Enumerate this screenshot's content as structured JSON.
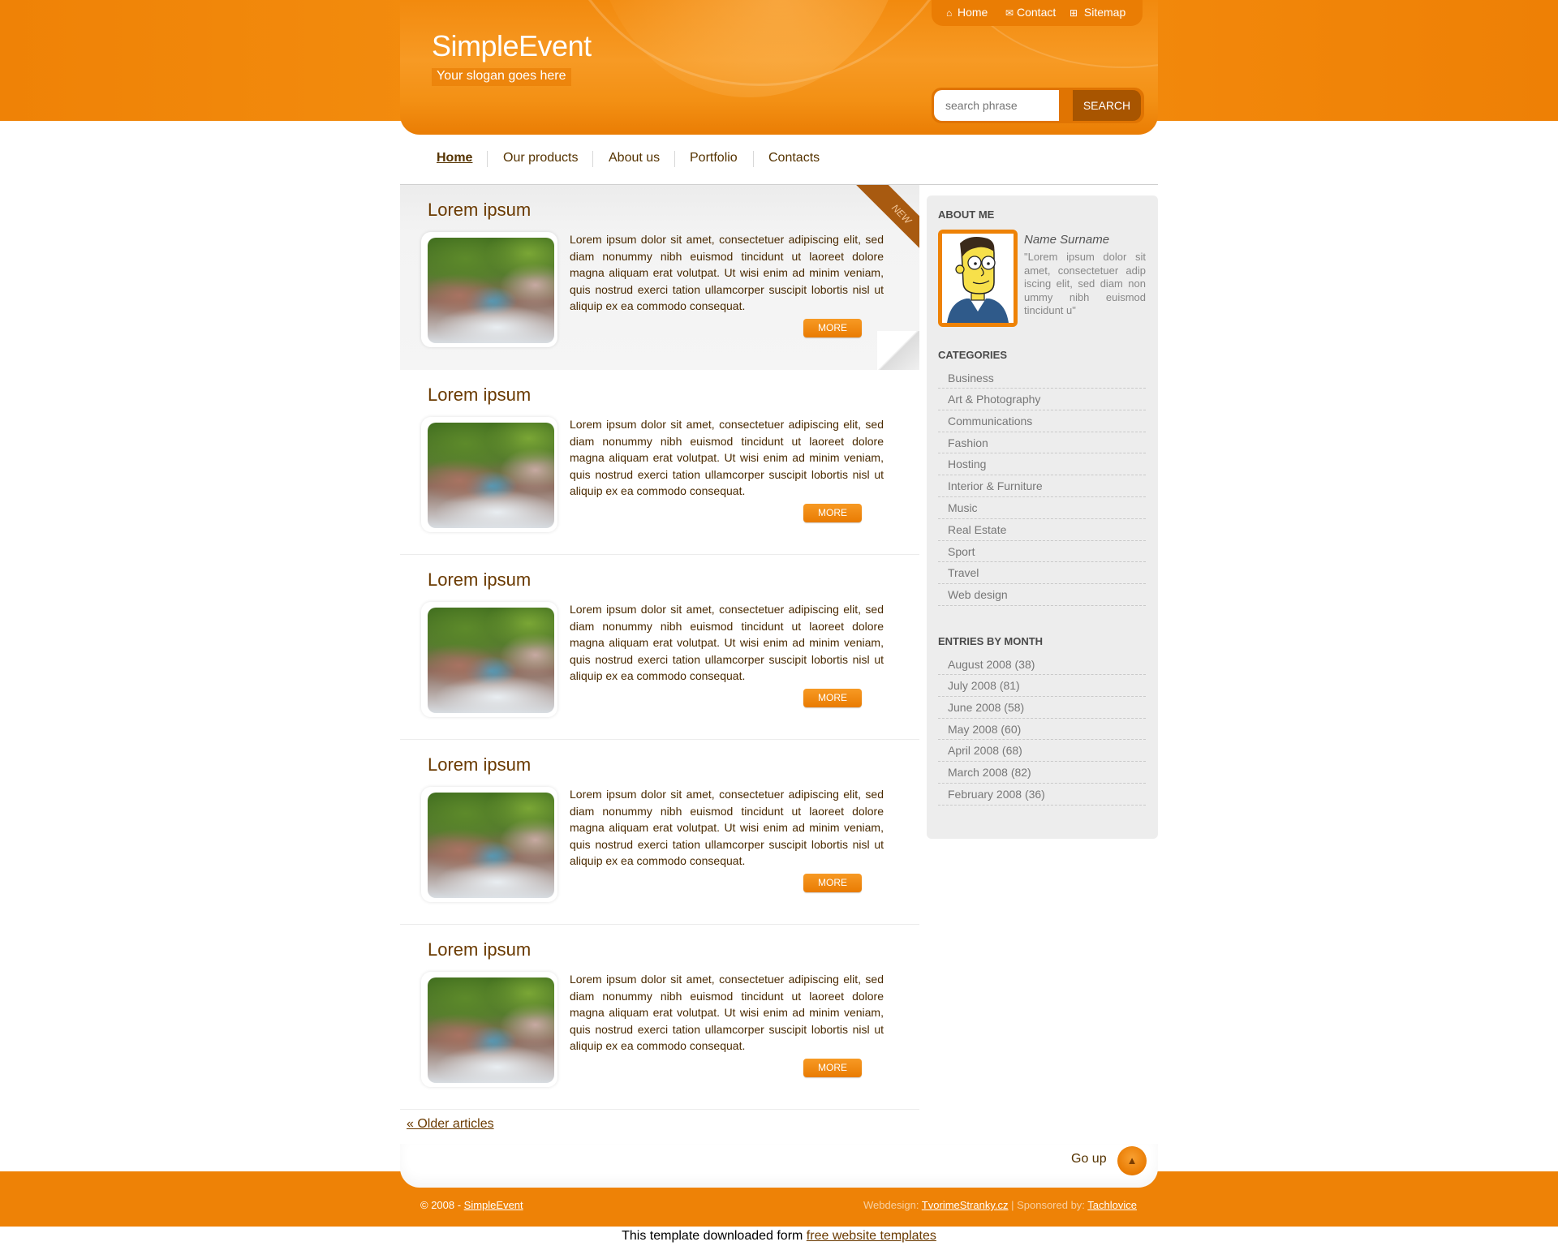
{
  "header": {
    "title": "SimpleEvent",
    "slogan": "Your slogan goes here",
    "top_links": [
      {
        "label": "Home",
        "icon": "home-icon"
      },
      {
        "label": "Contact",
        "icon": "mail-icon"
      },
      {
        "label": "Sitemap",
        "icon": "sitemap-icon"
      }
    ],
    "search": {
      "placeholder": "search phrase",
      "button_label": "SEARCH"
    }
  },
  "nav": {
    "items": [
      "Home",
      "Our products",
      "About us",
      "Portfolio",
      "Contacts"
    ],
    "active": "Home"
  },
  "articles": [
    {
      "title": "Lorem ipsum",
      "badge": "NEW",
      "body": "Lorem ipsum dolor sit amet, consectetuer adipiscing elit, sed diam nonummy nibh euismod tincidunt ut laoreet dolore magna aliquam erat volutpat. Ut wisi enim ad minim veniam, quis nostrud exerci tation ullamcorper suscipit lobortis nisl ut aliquip ex ea commodo consequat.",
      "more_label": "MORE"
    },
    {
      "title": "Lorem ipsum",
      "body": "Lorem ipsum dolor sit amet, consectetuer adipiscing elit, sed diam nonummy nibh euismod tincidunt ut laoreet dolore magna aliquam erat volutpat. Ut wisi enim ad minim veniam, quis nostrud exerci tation ullamcorper suscipit lobortis nisl ut aliquip ex ea commodo consequat.",
      "more_label": "MORE"
    },
    {
      "title": "Lorem ipsum",
      "body": "Lorem ipsum dolor sit amet, consectetuer adipiscing elit, sed diam nonummy nibh euismod tincidunt ut laoreet dolore magna aliquam erat volutpat. Ut wisi enim ad minim veniam, quis nostrud exerci tation ullamcorper suscipit lobortis nisl ut aliquip ex ea commodo consequat.",
      "more_label": "MORE"
    },
    {
      "title": "Lorem ipsum",
      "body": "Lorem ipsum dolor sit amet, consectetuer adipiscing elit, sed diam nonummy nibh euismod tincidunt ut laoreet dolore magna aliquam erat volutpat. Ut wisi enim ad minim veniam, quis nostrud exerci tation ullamcorper suscipit lobortis nisl ut aliquip ex ea commodo consequat.",
      "more_label": "MORE"
    },
    {
      "title": "Lorem ipsum",
      "body": "Lorem ipsum dolor sit amet, consectetuer adipiscing elit, sed diam nonummy nibh euismod tincidunt ut laoreet dolore magna aliquam erat volutpat. Ut wisi enim ad minim veniam, quis nostrud exerci tation ullamcorper suscipit lobortis nisl ut aliquip ex ea commodo consequat.",
      "more_label": "MORE"
    }
  ],
  "older_articles_label": "« Older articles",
  "sidebar": {
    "about": {
      "heading": "ABOUT ME",
      "name": "Name Surname",
      "quote": "\"Lorem ipsum dolor sit amet, consectetuer adip iscing elit, sed diam non ummy nibh euismod tincidunt u\""
    },
    "categories": {
      "heading": "CATEGORIES",
      "items": [
        "Business",
        "Art & Photography",
        "Communications",
        "Fashion",
        "Hosting",
        "Interior & Furniture",
        "Music",
        "Real Estate",
        "Sport",
        "Travel",
        "Web design"
      ]
    },
    "months": {
      "heading": "ENTRIES BY MONTH",
      "items": [
        "August 2008 (38)",
        "July 2008 (81)",
        "June 2008 (58)",
        "May 2008 (60)",
        "April 2008 (68)",
        "March 2008 (82)",
        "February 2008 (36)"
      ]
    }
  },
  "footer": {
    "go_up_label": "Go up",
    "copyright_prefix": "© 2008 - ",
    "site_link": "SimpleEvent",
    "webdesign_label": "Webdesign: ",
    "webdesign_link": "TvorimeStranky.cz",
    "sponsored_label": " | Sponsored by: ",
    "sponsored_link": "Tachlovice",
    "credit_text": "This template downloaded form ",
    "credit_link": "free website templates"
  },
  "colors": {
    "accent": "#ee8206",
    "accent_dark": "#a85500",
    "text_brown": "#553300"
  }
}
